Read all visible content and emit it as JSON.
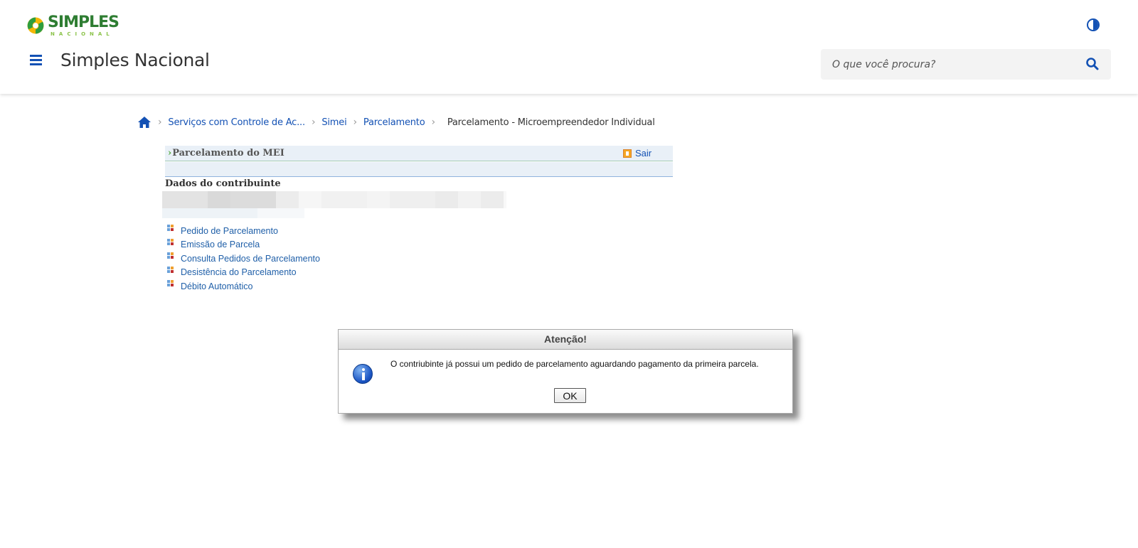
{
  "header": {
    "logo_word": "SIMPLES",
    "logo_sub": "NACIONAL",
    "site_title": "Simples Nacional",
    "search_placeholder": "O que você procura?",
    "contrast_icon": "contrast-icon",
    "menu_icon": "hamburger-menu-icon",
    "search_icon": "search-icon"
  },
  "breadcrumb": {
    "home_icon": "home-icon",
    "items": [
      "Serviços com Controle de Ac...",
      "Simei",
      "Parcelamento"
    ],
    "current": "Parcelamento - Microempreendedor Individual"
  },
  "panel": {
    "title": "Parcelamento do MEI",
    "exit_label": "Sair",
    "section_title": "Dados do contribuinte"
  },
  "menu": {
    "items": [
      "Pedido de Parcelamento",
      "Emissão de Parcela",
      "Consulta Pedidos de Parcelamento",
      "Desistência do Parcelamento",
      "Débito Automático"
    ]
  },
  "dialog": {
    "title": "Atenção!",
    "message": "O contriubinte já possui um pedido de parcelamento aguardando pagamento da primeira parcela.",
    "ok_label": "OK",
    "icon": "info-icon"
  },
  "colors": {
    "brand_blue": "#1351b4",
    "link_blue": "#1f5fa8",
    "logo_green": "#2e7d32",
    "panel_bg": "#e9f0f7"
  }
}
